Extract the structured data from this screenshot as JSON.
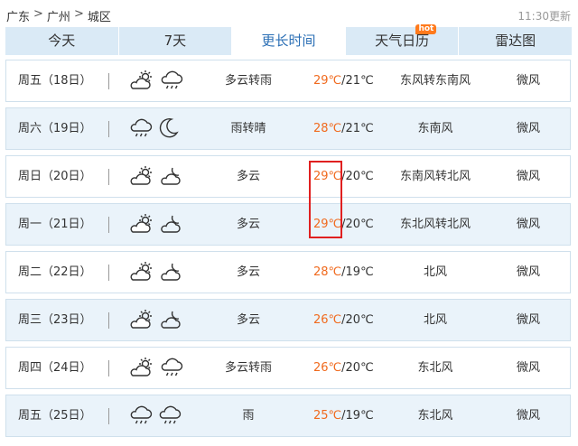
{
  "breadcrumb": [
    "广东",
    "广州",
    "城区"
  ],
  "breadcrumb_sep": ">",
  "update_time": "11:30更新",
  "tabs": [
    {
      "label": "今天"
    },
    {
      "label": "7天"
    },
    {
      "label": "更长时间"
    },
    {
      "label": "天气日历",
      "badge": "hot"
    },
    {
      "label": "雷达图"
    }
  ],
  "active_tab_index": 2,
  "days": [
    {
      "day": "周五（18日）",
      "icons": [
        "partly-cloudy-icon",
        "rain-icon"
      ],
      "cond": "多云转雨",
      "hi": "29℃",
      "lo": "/21℃",
      "wind": "东风转东南风",
      "level": "微风"
    },
    {
      "day": "周六（19日）",
      "icons": [
        "rain-icon",
        "moon-icon"
      ],
      "cond": "雨转晴",
      "hi": "28℃",
      "lo": "/21℃",
      "wind": "东南风",
      "level": "微风"
    },
    {
      "day": "周日（20日）",
      "icons": [
        "partly-cloudy-icon",
        "cloudy-night-icon"
      ],
      "cond": "多云",
      "hi": "29℃",
      "lo": "/20℃",
      "wind": "东南风转北风",
      "level": "微风"
    },
    {
      "day": "周一（21日）",
      "icons": [
        "partly-cloudy-icon",
        "cloudy-night-icon"
      ],
      "cond": "多云",
      "hi": "29℃",
      "lo": "/20℃",
      "wind": "东北风转北风",
      "level": "微风"
    },
    {
      "day": "周二（22日）",
      "icons": [
        "partly-cloudy-icon",
        "cloudy-night-icon"
      ],
      "cond": "多云",
      "hi": "28℃",
      "lo": "/19℃",
      "wind": "北风",
      "level": "微风"
    },
    {
      "day": "周三（23日）",
      "icons": [
        "partly-cloudy-icon",
        "cloudy-night-icon"
      ],
      "cond": "多云",
      "hi": "26℃",
      "lo": "/20℃",
      "wind": "北风",
      "level": "微风"
    },
    {
      "day": "周四（24日）",
      "icons": [
        "partly-cloudy-icon",
        "rain-icon"
      ],
      "cond": "多云转雨",
      "hi": "26℃",
      "lo": "/20℃",
      "wind": "东北风",
      "level": "微风"
    },
    {
      "day": "周五（25日）",
      "icons": [
        "rain-icon",
        "rain-icon"
      ],
      "cond": "雨",
      "hi": "25℃",
      "lo": "/19℃",
      "wind": "东北风",
      "level": "微风"
    }
  ],
  "colors": {
    "accent": "#2b6fb5",
    "hi_temp": "#f06a1e",
    "tab_bg": "#daeaf6",
    "row_alt": "#eaf3fa",
    "hot_badge": "#ff7a1c",
    "highlight": "#e02020"
  }
}
